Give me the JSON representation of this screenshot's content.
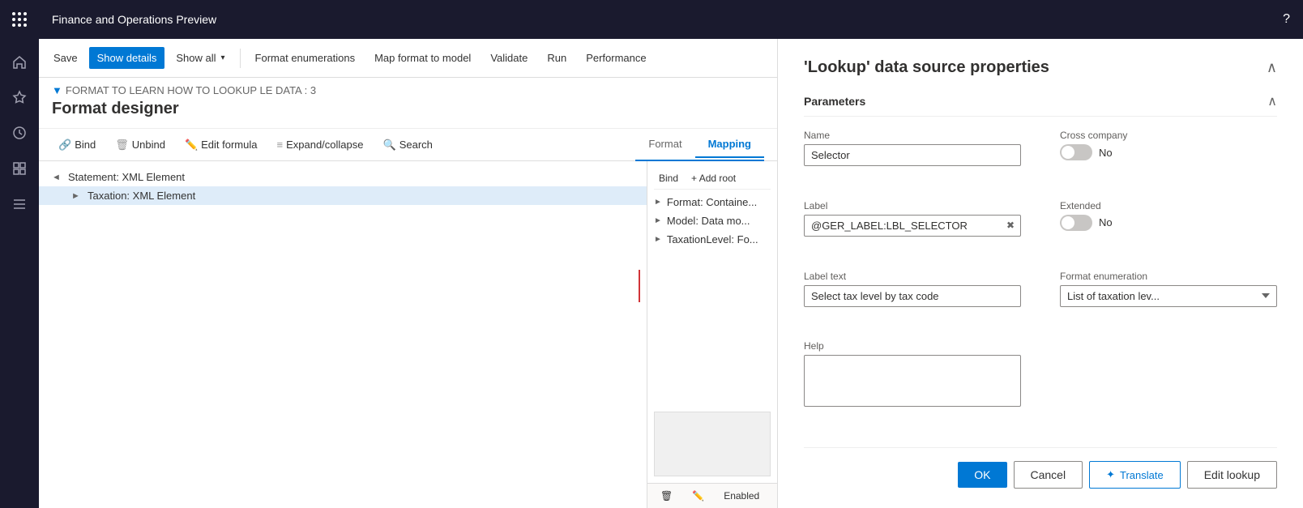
{
  "app": {
    "title": "Finance and Operations Preview",
    "help_icon": "?"
  },
  "toolbar": {
    "save_label": "Save",
    "show_details_label": "Show details",
    "show_all_label": "Show all",
    "format_enumerations_label": "Format enumerations",
    "map_format_to_model_label": "Map format to model",
    "validate_label": "Validate",
    "run_label": "Run",
    "performance_label": "Performance"
  },
  "title_area": {
    "breadcrumb": "FORMAT TO LEARN HOW TO LOOKUP LE DATA : 3",
    "page_title": "Format designer"
  },
  "sub_toolbar": {
    "bind_label": "Bind",
    "unbind_label": "Unbind",
    "edit_formula_label": "Edit formula",
    "expand_collapse_label": "Expand/collapse",
    "search_label": "Search"
  },
  "tabs": {
    "format_label": "Format",
    "mapping_label": "Mapping"
  },
  "tree": {
    "items": [
      {
        "label": "Statement: XML Element",
        "indent": 0,
        "expanded": true,
        "selected": false
      },
      {
        "label": "Taxation: XML Element",
        "indent": 1,
        "expanded": false,
        "selected": true
      }
    ]
  },
  "mapping": {
    "toolbar_bind": "Bind",
    "toolbar_add_root": "+ Add root",
    "items": [
      {
        "label": "Format: Containe..."
      },
      {
        "label": "Model: Data mo..."
      },
      {
        "label": "TaxationLevel: Fo..."
      }
    ],
    "enabled_label": "Enabled"
  },
  "right_panel": {
    "title": "'Lookup' data source properties",
    "section_title": "Parameters",
    "fields": {
      "name_label": "Name",
      "name_value": "Selector",
      "label_label": "Label",
      "label_value": "@GER_LABEL:LBL_SELECTOR",
      "label_text_label": "Label text",
      "label_text_value": "Select tax level by tax code",
      "help_label": "Help",
      "help_value": "",
      "cross_company_label": "Cross company",
      "cross_company_value": "No",
      "cross_company_toggle": false,
      "extended_label": "Extended",
      "extended_value": "No",
      "extended_toggle": false,
      "format_enumeration_label": "Format enumeration",
      "format_enumeration_value": "List of taxation lev..."
    },
    "buttons": {
      "ok_label": "OK",
      "cancel_label": "Cancel",
      "translate_label": "Translate",
      "edit_lookup_label": "Edit lookup"
    }
  }
}
